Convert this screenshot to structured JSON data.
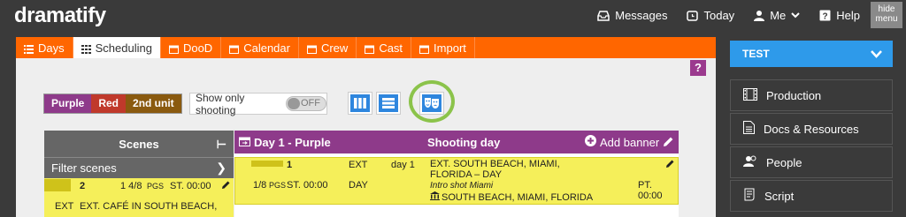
{
  "app": {
    "logo": "dramatify"
  },
  "topnav": {
    "messages": "Messages",
    "today": "Today",
    "me": "Me",
    "help": "Help",
    "hide_menu_line1": "hide",
    "hide_menu_line2": "menu"
  },
  "tabs": [
    {
      "label": "Days",
      "icon": "list-icon"
    },
    {
      "label": "Scheduling",
      "icon": "grid-icon",
      "active": true
    },
    {
      "label": "DooD",
      "icon": "calendar-icon"
    },
    {
      "label": "Calendar",
      "icon": "calendar-icon"
    },
    {
      "label": "Crew",
      "icon": "calendar-icon"
    },
    {
      "label": "Cast",
      "icon": "calendar-icon"
    },
    {
      "label": "Import",
      "icon": "calendar-icon"
    }
  ],
  "help_button": "?",
  "units": [
    {
      "label": "Purple",
      "color": "#8e3a8a"
    },
    {
      "label": "Red",
      "color": "#c0392b"
    },
    {
      "label": "2nd unit",
      "color": "#8a5a0f"
    }
  ],
  "toggle": {
    "label": "Show only shooting",
    "state": "OFF"
  },
  "scenes": {
    "title": "Scenes",
    "collapse_icon": "⊢",
    "filter_label": "Filter scenes",
    "row": {
      "num": "2",
      "pages": "1 4/8",
      "pages_unit": "PGS",
      "time": "ST. 00:00",
      "ie": "EXT",
      "title": "EXT. CAFÉ IN SOUTH BEACH,"
    }
  },
  "day": {
    "title": "Day 1 - Purple",
    "status": "Shooting day",
    "add_banner": "Add banner",
    "strip": {
      "num": "1",
      "ie": "EXT",
      "day": "day 1",
      "pages": "1/8",
      "pages_unit": "PGS",
      "time": "ST. 00:00",
      "daynight": "DAY",
      "location_line1": "EXT. SOUTH BEACH, MIAMI,",
      "location_line2": "FLORIDA – DAY",
      "note": "Intro shot Miami",
      "set": "SOUTH BEACH, MIAMI, FLORIDA",
      "pt": "PT. 00:00"
    }
  },
  "sidebar": {
    "project": "TEST",
    "items": [
      {
        "label": "Production",
        "icon": "film-icon"
      },
      {
        "label": "Docs & Resources",
        "icon": "document-icon"
      },
      {
        "label": "People",
        "icon": "people-icon"
      },
      {
        "label": "Script",
        "icon": "script-icon"
      }
    ]
  },
  "colors": {
    "accent": "#ff6600",
    "purple": "#8e3a8a",
    "strip_yellow": "#f5ef5a",
    "blue": "#2e9aea",
    "ring_green": "#8bc34a"
  }
}
